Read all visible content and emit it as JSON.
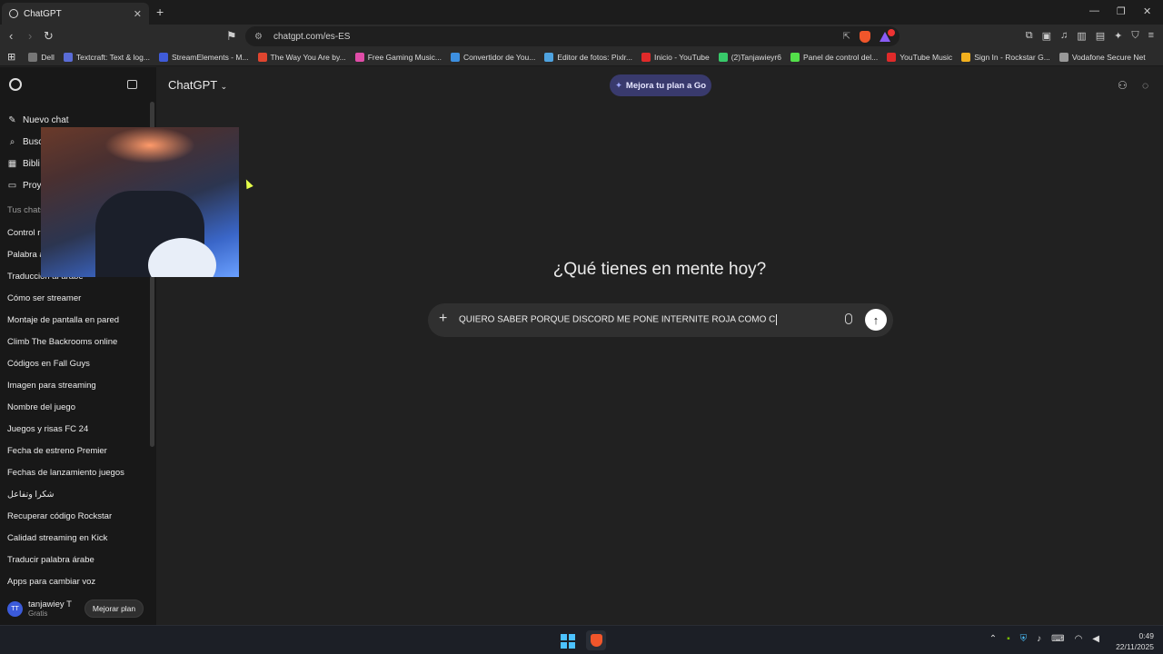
{
  "browser": {
    "tab_title": "ChatGPT",
    "url": "chatgpt.com/es-ES",
    "bookmarks": [
      {
        "label": "Dell",
        "color": "#777777"
      },
      {
        "label": "Textcraft: Text & log...",
        "color": "#5a6cd6"
      },
      {
        "label": "StreamElements - M...",
        "color": "#3f5bd8"
      },
      {
        "label": "The Way You Are by...",
        "color": "#e0452f"
      },
      {
        "label": "Free Gaming Music...",
        "color": "#e04da8"
      },
      {
        "label": "Convertidor de You...",
        "color": "#3d8fe0"
      },
      {
        "label": "Editor de fotos: Pixlr...",
        "color": "#4fa3e0"
      },
      {
        "label": "Inicio - YouTube",
        "color": "#e02a2a"
      },
      {
        "label": "(2)Tanjawieyr6",
        "color": "#38c96a"
      },
      {
        "label": "Panel de control del...",
        "color": "#53e04a"
      },
      {
        "label": "YouTube Music",
        "color": "#e02a2a"
      },
      {
        "label": "Sign In - Rockstar G...",
        "color": "#f2b01e"
      },
      {
        "label": "Vodafone Secure Net",
        "color": "#999999"
      }
    ]
  },
  "app": {
    "title": "ChatGPT",
    "upgrade_pill": "Mejora tu plan a Go",
    "headline": "¿Qué tienes en mente hoy?",
    "composer_text": "QUIERO SABER PORQUE DISCORD ME PONE INTERNITE ROJA COMO C"
  },
  "sidebar": {
    "menu": [
      {
        "label": "Nuevo chat",
        "icon": "edit-icon"
      },
      {
        "label": "Busc",
        "icon": "search-icon"
      },
      {
        "label": "Bibli",
        "icon": "library-icon"
      },
      {
        "label": "Proy",
        "icon": "folder-icon"
      }
    ],
    "section_label": "Tus chats",
    "chats": [
      "Control r",
      "Palabra á",
      "Traducción al árabe",
      "Cómo ser streamer",
      "Montaje de pantalla en pared",
      "Climb The Backrooms online",
      "Códigos en Fall Guys",
      "Imagen para streaming",
      "Nombre del juego",
      "Juegos y risas FC 24",
      "Fecha de estreno Premier",
      "Fechas de lanzamiento juegos",
      "شكرا وتفاعل",
      "Recuperar código Rockstar",
      "Calidad streaming en Kick",
      "Traducir palabra árabe",
      "Apps para cambiar voz"
    ],
    "user": {
      "initials": "TT",
      "name": "tanjawiey T",
      "plan": "Gratis",
      "upgrade": "Mejorar plan"
    }
  },
  "taskbar": {
    "time": "0:49",
    "date": "22/11/2025"
  }
}
